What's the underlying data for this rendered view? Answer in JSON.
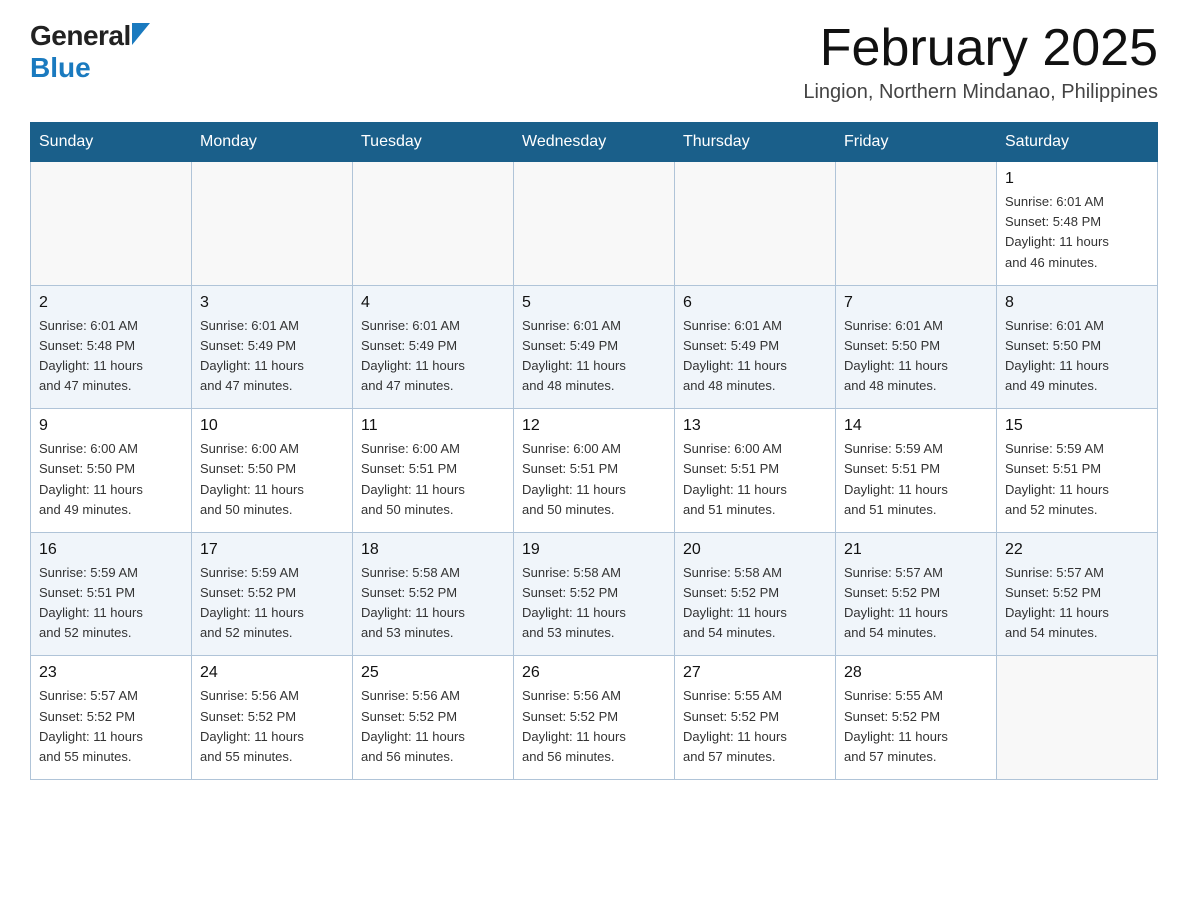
{
  "header": {
    "logo_general": "General",
    "logo_blue": "Blue",
    "month_title": "February 2025",
    "location": "Lingion, Northern Mindanao, Philippines"
  },
  "days_of_week": [
    "Sunday",
    "Monday",
    "Tuesday",
    "Wednesday",
    "Thursday",
    "Friday",
    "Saturday"
  ],
  "weeks": [
    {
      "days": [
        {
          "number": "",
          "info": "",
          "empty": true
        },
        {
          "number": "",
          "info": "",
          "empty": true
        },
        {
          "number": "",
          "info": "",
          "empty": true
        },
        {
          "number": "",
          "info": "",
          "empty": true
        },
        {
          "number": "",
          "info": "",
          "empty": true
        },
        {
          "number": "",
          "info": "",
          "empty": true
        },
        {
          "number": "1",
          "info": "Sunrise: 6:01 AM\nSunset: 5:48 PM\nDaylight: 11 hours\nand 46 minutes.",
          "empty": false
        }
      ]
    },
    {
      "days": [
        {
          "number": "2",
          "info": "Sunrise: 6:01 AM\nSunset: 5:48 PM\nDaylight: 11 hours\nand 47 minutes.",
          "empty": false
        },
        {
          "number": "3",
          "info": "Sunrise: 6:01 AM\nSunset: 5:49 PM\nDaylight: 11 hours\nand 47 minutes.",
          "empty": false
        },
        {
          "number": "4",
          "info": "Sunrise: 6:01 AM\nSunset: 5:49 PM\nDaylight: 11 hours\nand 47 minutes.",
          "empty": false
        },
        {
          "number": "5",
          "info": "Sunrise: 6:01 AM\nSunset: 5:49 PM\nDaylight: 11 hours\nand 48 minutes.",
          "empty": false
        },
        {
          "number": "6",
          "info": "Sunrise: 6:01 AM\nSunset: 5:49 PM\nDaylight: 11 hours\nand 48 minutes.",
          "empty": false
        },
        {
          "number": "7",
          "info": "Sunrise: 6:01 AM\nSunset: 5:50 PM\nDaylight: 11 hours\nand 48 minutes.",
          "empty": false
        },
        {
          "number": "8",
          "info": "Sunrise: 6:01 AM\nSunset: 5:50 PM\nDaylight: 11 hours\nand 49 minutes.",
          "empty": false
        }
      ]
    },
    {
      "days": [
        {
          "number": "9",
          "info": "Sunrise: 6:00 AM\nSunset: 5:50 PM\nDaylight: 11 hours\nand 49 minutes.",
          "empty": false
        },
        {
          "number": "10",
          "info": "Sunrise: 6:00 AM\nSunset: 5:50 PM\nDaylight: 11 hours\nand 50 minutes.",
          "empty": false
        },
        {
          "number": "11",
          "info": "Sunrise: 6:00 AM\nSunset: 5:51 PM\nDaylight: 11 hours\nand 50 minutes.",
          "empty": false
        },
        {
          "number": "12",
          "info": "Sunrise: 6:00 AM\nSunset: 5:51 PM\nDaylight: 11 hours\nand 50 minutes.",
          "empty": false
        },
        {
          "number": "13",
          "info": "Sunrise: 6:00 AM\nSunset: 5:51 PM\nDaylight: 11 hours\nand 51 minutes.",
          "empty": false
        },
        {
          "number": "14",
          "info": "Sunrise: 5:59 AM\nSunset: 5:51 PM\nDaylight: 11 hours\nand 51 minutes.",
          "empty": false
        },
        {
          "number": "15",
          "info": "Sunrise: 5:59 AM\nSunset: 5:51 PM\nDaylight: 11 hours\nand 52 minutes.",
          "empty": false
        }
      ]
    },
    {
      "days": [
        {
          "number": "16",
          "info": "Sunrise: 5:59 AM\nSunset: 5:51 PM\nDaylight: 11 hours\nand 52 minutes.",
          "empty": false
        },
        {
          "number": "17",
          "info": "Sunrise: 5:59 AM\nSunset: 5:52 PM\nDaylight: 11 hours\nand 52 minutes.",
          "empty": false
        },
        {
          "number": "18",
          "info": "Sunrise: 5:58 AM\nSunset: 5:52 PM\nDaylight: 11 hours\nand 53 minutes.",
          "empty": false
        },
        {
          "number": "19",
          "info": "Sunrise: 5:58 AM\nSunset: 5:52 PM\nDaylight: 11 hours\nand 53 minutes.",
          "empty": false
        },
        {
          "number": "20",
          "info": "Sunrise: 5:58 AM\nSunset: 5:52 PM\nDaylight: 11 hours\nand 54 minutes.",
          "empty": false
        },
        {
          "number": "21",
          "info": "Sunrise: 5:57 AM\nSunset: 5:52 PM\nDaylight: 11 hours\nand 54 minutes.",
          "empty": false
        },
        {
          "number": "22",
          "info": "Sunrise: 5:57 AM\nSunset: 5:52 PM\nDaylight: 11 hours\nand 54 minutes.",
          "empty": false
        }
      ]
    },
    {
      "days": [
        {
          "number": "23",
          "info": "Sunrise: 5:57 AM\nSunset: 5:52 PM\nDaylight: 11 hours\nand 55 minutes.",
          "empty": false
        },
        {
          "number": "24",
          "info": "Sunrise: 5:56 AM\nSunset: 5:52 PM\nDaylight: 11 hours\nand 55 minutes.",
          "empty": false
        },
        {
          "number": "25",
          "info": "Sunrise: 5:56 AM\nSunset: 5:52 PM\nDaylight: 11 hours\nand 56 minutes.",
          "empty": false
        },
        {
          "number": "26",
          "info": "Sunrise: 5:56 AM\nSunset: 5:52 PM\nDaylight: 11 hours\nand 56 minutes.",
          "empty": false
        },
        {
          "number": "27",
          "info": "Sunrise: 5:55 AM\nSunset: 5:52 PM\nDaylight: 11 hours\nand 57 minutes.",
          "empty": false
        },
        {
          "number": "28",
          "info": "Sunrise: 5:55 AM\nSunset: 5:52 PM\nDaylight: 11 hours\nand 57 minutes.",
          "empty": false
        },
        {
          "number": "",
          "info": "",
          "empty": true
        }
      ]
    }
  ]
}
